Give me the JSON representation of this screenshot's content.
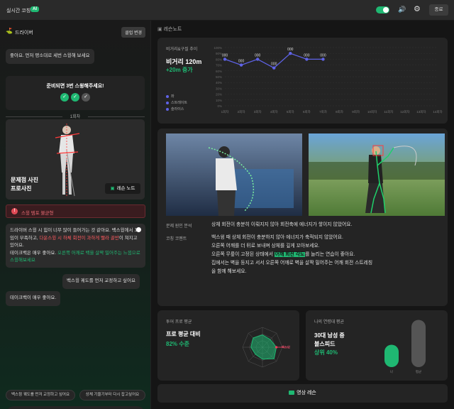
{
  "app": {
    "title": "실시간 코칭",
    "ai_badge": "AI",
    "exit_label": "종료"
  },
  "chat": {
    "club_label": "드라이버",
    "club_change": "클럽 변경",
    "msg1": "좋아요. 먼저 평소대로 세번 스윙해 보세요",
    "ready_text": "준비되면 3번 스윙해주세요!",
    "round_label": "1회차",
    "photo_title_1": "문제점 사진",
    "photo_title_2": "프로사진",
    "lesson_note_btn": "레슨 노트",
    "alert_text": "스윙 템포 불균형",
    "analysis": {
      "p1": "드라이버 스윙 시 힘이 너무 많이 들어가는 것 같아요. 백스윙에서 꼬임이 부족하고, ",
      "p1_red": "다운스윙 시 하체 회전이 과하게 빨라 골반",
      "p1_end": "이 쳐지고 있어요.",
      "p2": "테이크백은 매우 좋아요. ",
      "p2_green": "오른쪽 어깨로 백을 살짝 밀어주는 느낌으로 스윙해보세요"
    },
    "user_msg": "백스윙 궤도를 먼저 교정하고 싶어요",
    "ai_msg2": "테이크백이 매우 좋아요.",
    "suggestions": [
      "백스윙 궤도를 먼저 교정하고 싶어요",
      "상체 기울기부터 다시 잡고싶어요"
    ]
  },
  "lesson_note": {
    "header": "레슨노트",
    "chart": {
      "label": "비거리&구질 추이",
      "big": "비거리 120m",
      "delta": "+20m 증가",
      "legend": [
        "좌",
        "스트레이트",
        "슬라이스"
      ]
    },
    "analysis": {
      "cause_label": "문제 원인 분석",
      "cause_text": "상체 회전이 충분히 이뤄지지 않아 회전축에 에너지가 쌓이지 않았어요.",
      "coach_label": "코칭 코멘트",
      "coach_lines": [
        "백스윙 때 상체 회전이 충분하지 않아 에너지가 축적되지 않았어요.",
        "오른쪽 어깨를 더 뒤로 보내며 상체를 깊게 꼬아보세요.",
        "오른쪽 무릎이 고정된 상태에서 ",
        "어깨 회전 각도",
        "를 늘리는 연습이 좋아요.",
        "집에서는 벽을 등지고 서서 오른쪽 어깨로 벽을 살짝 밀어주는 어깨 회전 스트레칭",
        "을 함께 해보세요."
      ]
    },
    "tour": {
      "label": "투어 프로 평균",
      "big": "프로 평균 대비",
      "value": "82% 수준"
    },
    "age": {
      "label": "나의 연령대 평균",
      "big_1": "30대 남성 중",
      "big_2": "볼스피드",
      "value": "상위 40%"
    },
    "video_btn": "영상 레슨"
  },
  "chart_data": {
    "type": "line",
    "title": "비거리&구질 추이",
    "categories": [
      "1회차",
      "2회차",
      "3회차",
      "4회차",
      "5회차",
      "6회차",
      "7회차",
      "8회차",
      "9회차",
      "10회차",
      "11회차",
      "12회차",
      "13회차",
      "14회차"
    ],
    "values": [
      80,
      70,
      80,
      65,
      90,
      80,
      80
    ],
    "data_labels": [
      "000",
      "000",
      "000",
      "000",
      "000",
      "000",
      "000"
    ],
    "ylim": [
      0,
      100
    ]
  },
  "radar_data": {
    "axes": 8,
    "values": [
      0.62,
      0.55,
      0.7,
      0.82,
      0.6,
      0.5,
      0.58,
      0.66
    ],
    "marker": "백스윙"
  },
  "bar_data": {
    "labels": [
      "나",
      "평균"
    ],
    "values": [
      0.45,
      0.95
    ]
  }
}
